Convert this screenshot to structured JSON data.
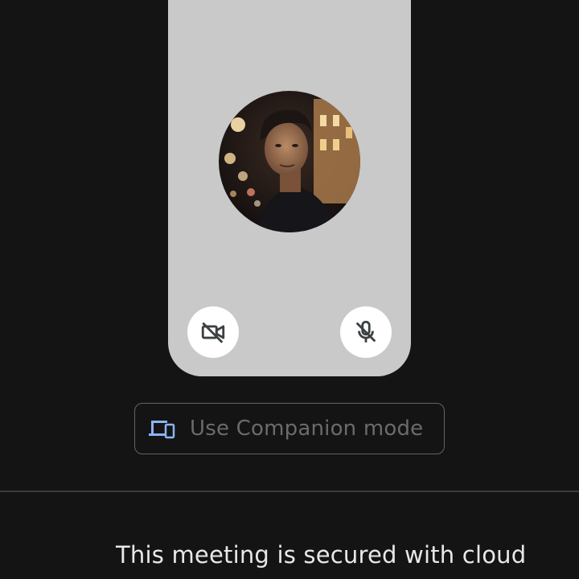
{
  "preview": {
    "avatar": "user-profile-photo",
    "camera_toggle": {
      "icon": "video-off-icon",
      "state": "off"
    },
    "mic_toggle": {
      "icon": "mic-off-icon",
      "state": "off"
    }
  },
  "companion_button": {
    "icon": "devices-icon",
    "label": "Use Companion mode"
  },
  "footer": {
    "security_text": "This meeting is secured with cloud"
  },
  "colors": {
    "background": "#141414",
    "preview_card": "#c8c9c8",
    "accent_icon": "#8ab4f8"
  }
}
